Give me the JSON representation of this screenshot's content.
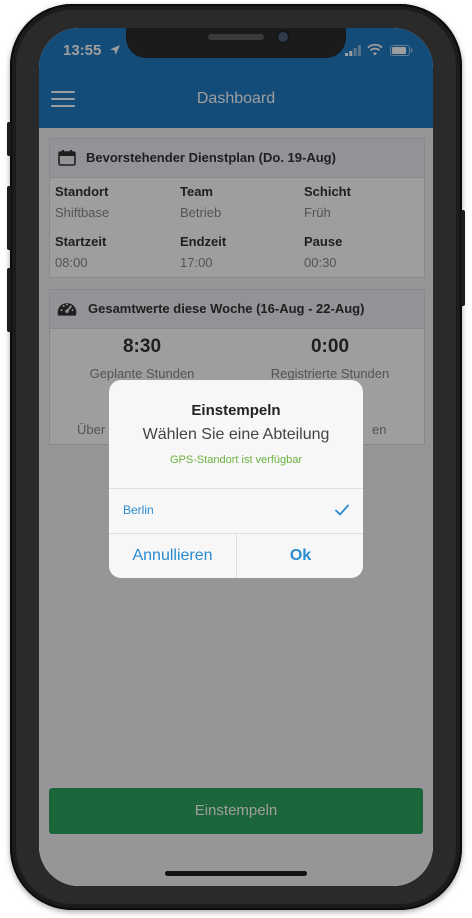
{
  "status_bar": {
    "time": "13:55"
  },
  "app_bar": {
    "title": "Dashboard"
  },
  "schedule_card": {
    "title": "Bevorstehender Dienstplan (Do. 19-Aug)",
    "rows": [
      [
        {
          "label": "Standort",
          "value": "Shiftbase"
        },
        {
          "label": "Team",
          "value": "Betrieb"
        },
        {
          "label": "Schicht",
          "value": "Früh"
        }
      ],
      [
        {
          "label": "Startzeit",
          "value": "08:00"
        },
        {
          "label": "Endzeit",
          "value": "17:00"
        },
        {
          "label": "Pause",
          "value": "00:30"
        }
      ]
    ]
  },
  "totals_card": {
    "title": "Gesamtwerte diese Woche (16-Aug - 22-Aug)",
    "planned": {
      "value": "8:30",
      "caption": "Geplante Stunden"
    },
    "registered": {
      "value": "0:00",
      "caption": "Registrierte Stunden"
    },
    "partial_left": "Über",
    "partial_right": "en"
  },
  "clock_in_button": {
    "label": "Einstempeln"
  },
  "dialog": {
    "title": "Einstempeln",
    "subtitle": "Wählen Sie eine Abteilung",
    "gps_status": "GPS-Standort ist verfügbar",
    "option": "Berlin",
    "cancel_label": "Annullieren",
    "ok_label": "Ok"
  },
  "colors": {
    "primary": "#1f7ac4",
    "button_green": "#2fa35f",
    "gps_green": "#6cb33f",
    "link_blue": "#2a8bd0"
  },
  "icons": [
    "location-arrow-icon",
    "signal-icon",
    "wifi-icon",
    "battery-icon",
    "menu-icon",
    "calendar-icon",
    "speedometer-icon",
    "checkmark-icon"
  ]
}
